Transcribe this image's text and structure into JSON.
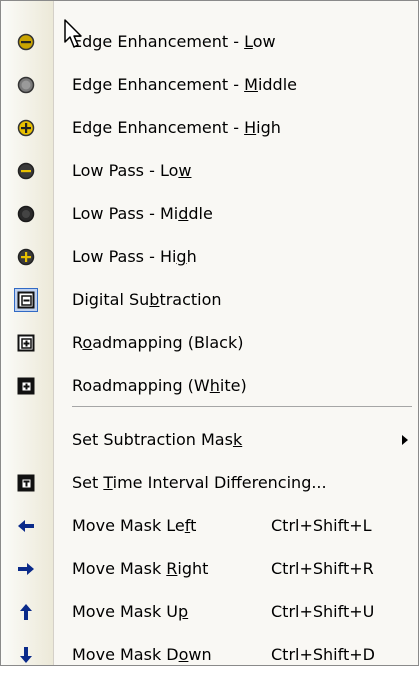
{
  "menu": {
    "items": [
      {
        "label": "Edge Enhancement - Low",
        "icon": "filter-edge-low-icon"
      },
      {
        "label": "Edge Enhancement - Middle",
        "icon": "filter-edge-middle-icon"
      },
      {
        "label": "Edge Enhancement - High",
        "icon": "filter-edge-high-icon"
      },
      {
        "label": "Low Pass - Low",
        "icon": "filter-lowpass-low-icon"
      },
      {
        "label": "Low Pass - Middle",
        "icon": "filter-lowpass-middle-icon"
      },
      {
        "label": "Low Pass - High",
        "icon": "filter-lowpass-high-icon"
      },
      {
        "label": "Digital Subtraction",
        "icon": "digital-subtraction-icon"
      },
      {
        "label": "Roadmapping (Black)",
        "icon": "roadmapping-black-icon"
      },
      {
        "label": "Roadmapping (White)",
        "icon": "roadmapping-white-icon"
      },
      {
        "label": "Set Subtraction Mask",
        "icon": "none"
      },
      {
        "label": "Set Time Interval Differencing...",
        "icon": "time-interval-differencing-icon"
      },
      {
        "label": "Move Mask Left",
        "shortcut": "Ctrl+Shift+L",
        "icon": "arrow-left-icon"
      },
      {
        "label": "Move Mask Right",
        "shortcut": "Ctrl+Shift+R",
        "icon": "arrow-right-icon"
      },
      {
        "label": "Move Mask Up",
        "shortcut": "Ctrl+Shift+U",
        "icon": "arrow-up-icon"
      },
      {
        "label": "Move Mask Down",
        "shortcut": "Ctrl+Shift+D",
        "icon": "arrow-down-icon"
      }
    ]
  },
  "colors": {
    "gutter": "#ece9d8",
    "menu_bg": "#f9f8f4",
    "icon_dark": "#333333",
    "icon_yellow": "#e8c000",
    "arrow_blue": "#0a2a8a"
  }
}
